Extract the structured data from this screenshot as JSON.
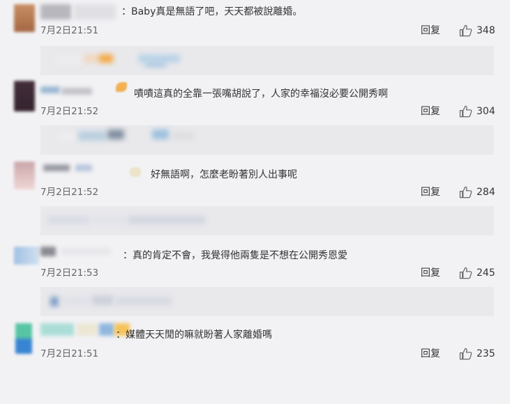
{
  "comments": [
    {
      "text": "：Baby真是無語了吧，天天都被說離婚。",
      "time": "7月2日21:51",
      "reply_label": "回复",
      "likes": "348",
      "has_reply_box": true
    },
    {
      "text": "嘖嘖這真的全靠一張嘴胡說了，人家的幸福沒必要公開秀啊",
      "time": "7月2日21:52",
      "reply_label": "回复",
      "likes": "304",
      "has_reply_box": true
    },
    {
      "text": "好無語啊，怎麼老盼著別人出事呢",
      "time": "7月2日21:52",
      "reply_label": "回复",
      "likes": "284",
      "has_reply_box": true
    },
    {
      "text": "：真的肯定不會，我覺得他兩隻是不想在公開秀恩愛",
      "time": "7月2日21:53",
      "reply_label": "回复",
      "likes": "245",
      "has_reply_box": true
    },
    {
      "text": "：媒體天天閒的嘛就盼著人家離婚嗎",
      "time": "7月2日21:51",
      "reply_label": "回复",
      "likes": "235",
      "has_reply_box": false
    }
  ],
  "colors": {
    "background": "#f2f2f5",
    "reply_box": "#e9e9ec",
    "text": "#333333",
    "muted": "#666666"
  },
  "icons": {
    "like": "thumbs-up-icon"
  }
}
